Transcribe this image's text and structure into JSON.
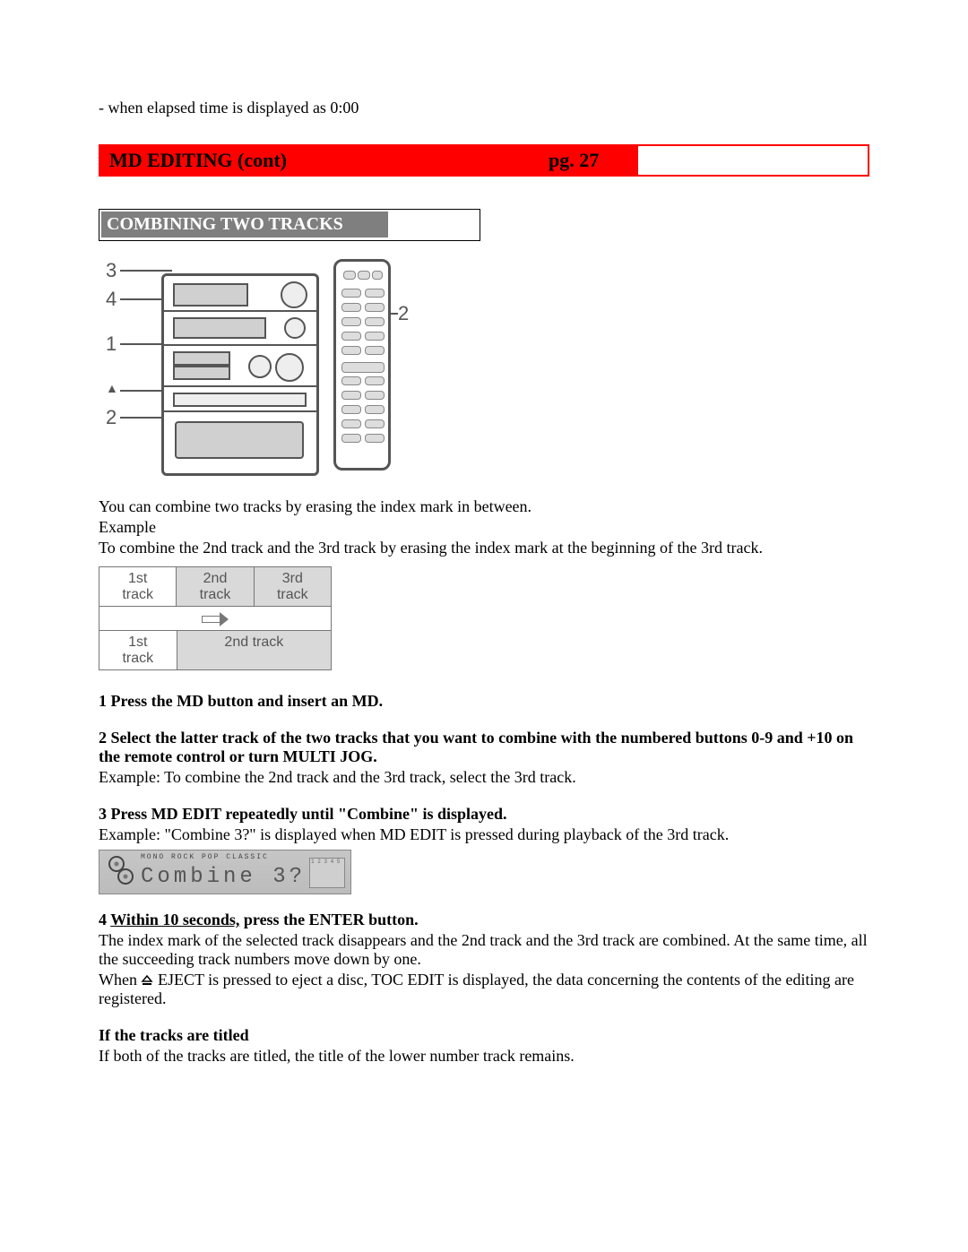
{
  "top_line": "- when elapsed time is displayed as 0:00",
  "banner": {
    "title": "MD EDITING (cont)",
    "page": "pg. 27"
  },
  "subheading": "COMBINING TWO TRACKS",
  "callouts": {
    "c3": "3",
    "c4": "4",
    "c1": "1",
    "c2_left": "2",
    "c2_right": "2",
    "eject": "▲"
  },
  "intro": {
    "l1": "You can combine two tracks by erasing the index mark in between.",
    "l2": "Example",
    "l3": "To combine the 2nd track and the 3rd track by erasing the index mark at the beginning of the 3rd track."
  },
  "tracks": {
    "before": [
      "1st\ntrack",
      "2nd\ntrack",
      "3rd\ntrack"
    ],
    "after": [
      "1st\ntrack",
      "2nd track"
    ]
  },
  "steps": {
    "s1": "1 Press the MD button and insert an MD.",
    "s2": "2 Select the latter track of the two tracks that you want to combine with the numbered buttons 0-9 and +10 on the remote control or turn MULTI JOG.",
    "s2ex": "Example: To combine the 2nd track and the 3rd track, select the 3rd track.",
    "s3": "3 Press MD EDIT repeatedly until \"Combine\" is displayed.",
    "s3ex": "Example: \"Combine 3?\" is displayed when MD EDIT is pressed during playback of the 3rd track.",
    "s4a": "4 ",
    "s4u": "Within 10 seconds,",
    "s4b": " press the ENTER button.",
    "s4body1": "The index mark of the selected track disappears and the 2nd track and the 3rd track are combined.  At the same time, all the succeeding track numbers move down by one.",
    "s4body2a": "When ",
    "s4body2b": " EJECT is pressed to eject a disc, TOC EDIT is displayed, the data concerning the contents of the editing are registered.",
    "ift": "If the tracks are titled",
    "iftbody": "If both of the tracks are titled, the title of the lower number track remains."
  },
  "lcd": {
    "top": "MONO   ROCK   POP   CLASSIC",
    "text": "Combine  3?",
    "right": "1 2 3 4 5"
  }
}
